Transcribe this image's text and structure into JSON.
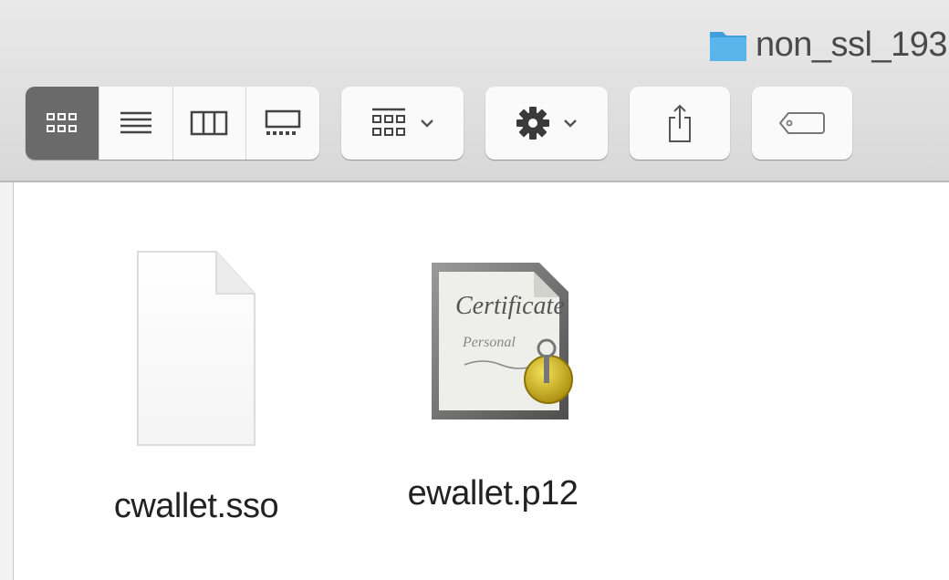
{
  "window": {
    "title": "non_ssl_193",
    "title_icon": "folder-icon"
  },
  "toolbar": {
    "view_modes": [
      {
        "name": "icon-view",
        "icon": "grid-icon",
        "active": true
      },
      {
        "name": "list-view",
        "icon": "list-icon",
        "active": false
      },
      {
        "name": "column-view",
        "icon": "columns-icon",
        "active": false
      },
      {
        "name": "gallery-view",
        "icon": "gallery-icon",
        "active": false
      }
    ],
    "group_button_icon": "group-grid-icon",
    "action_button_icon": "gear-icon",
    "share_button_icon": "share-icon",
    "tag_button_icon": "tag-icon"
  },
  "files": [
    {
      "name": "cwallet.sso",
      "icon": "blank-document-icon"
    },
    {
      "name": "ewallet.p12",
      "icon": "certificate-icon"
    }
  ],
  "colors": {
    "folder_blue": "#5ab5ec",
    "active_segment": "#6a6a6a",
    "seal_gold": "#cfb21a"
  }
}
